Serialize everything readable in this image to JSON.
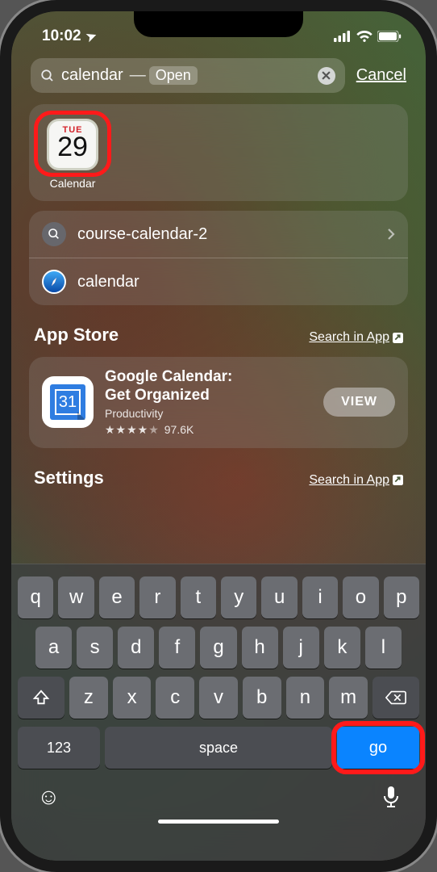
{
  "status": {
    "time": "10:02",
    "location_glyph": "➤"
  },
  "search": {
    "query": "calendar",
    "open_hint_prefix": "—",
    "open_hint": "Open",
    "cancel": "Cancel"
  },
  "top_app": {
    "label": "Calendar",
    "day_of_week": "TUE",
    "day_number": "29"
  },
  "suggestions": [
    {
      "icon": "search",
      "label": "course-calendar-2",
      "chevron": true
    },
    {
      "icon": "safari",
      "label": "calendar",
      "chevron": false
    }
  ],
  "sections": {
    "app_store": {
      "title": "App Store",
      "link": "Search in App",
      "item": {
        "name_line1": "Google Calendar:",
        "name_line2": "Get Organized",
        "category": "Productivity",
        "stars_glyphs": "★★★★½",
        "rating_count": "97.6K",
        "icon_day": "31",
        "view_label": "VIEW"
      }
    },
    "settings": {
      "title": "Settings",
      "link": "Search in App"
    }
  },
  "keyboard": {
    "row1": [
      "q",
      "w",
      "e",
      "r",
      "t",
      "y",
      "u",
      "i",
      "o",
      "p"
    ],
    "row2": [
      "a",
      "s",
      "d",
      "f",
      "g",
      "h",
      "j",
      "k",
      "l"
    ],
    "row3": [
      "z",
      "x",
      "c",
      "v",
      "b",
      "n",
      "m"
    ],
    "num": "123",
    "space": "space",
    "go": "go"
  }
}
